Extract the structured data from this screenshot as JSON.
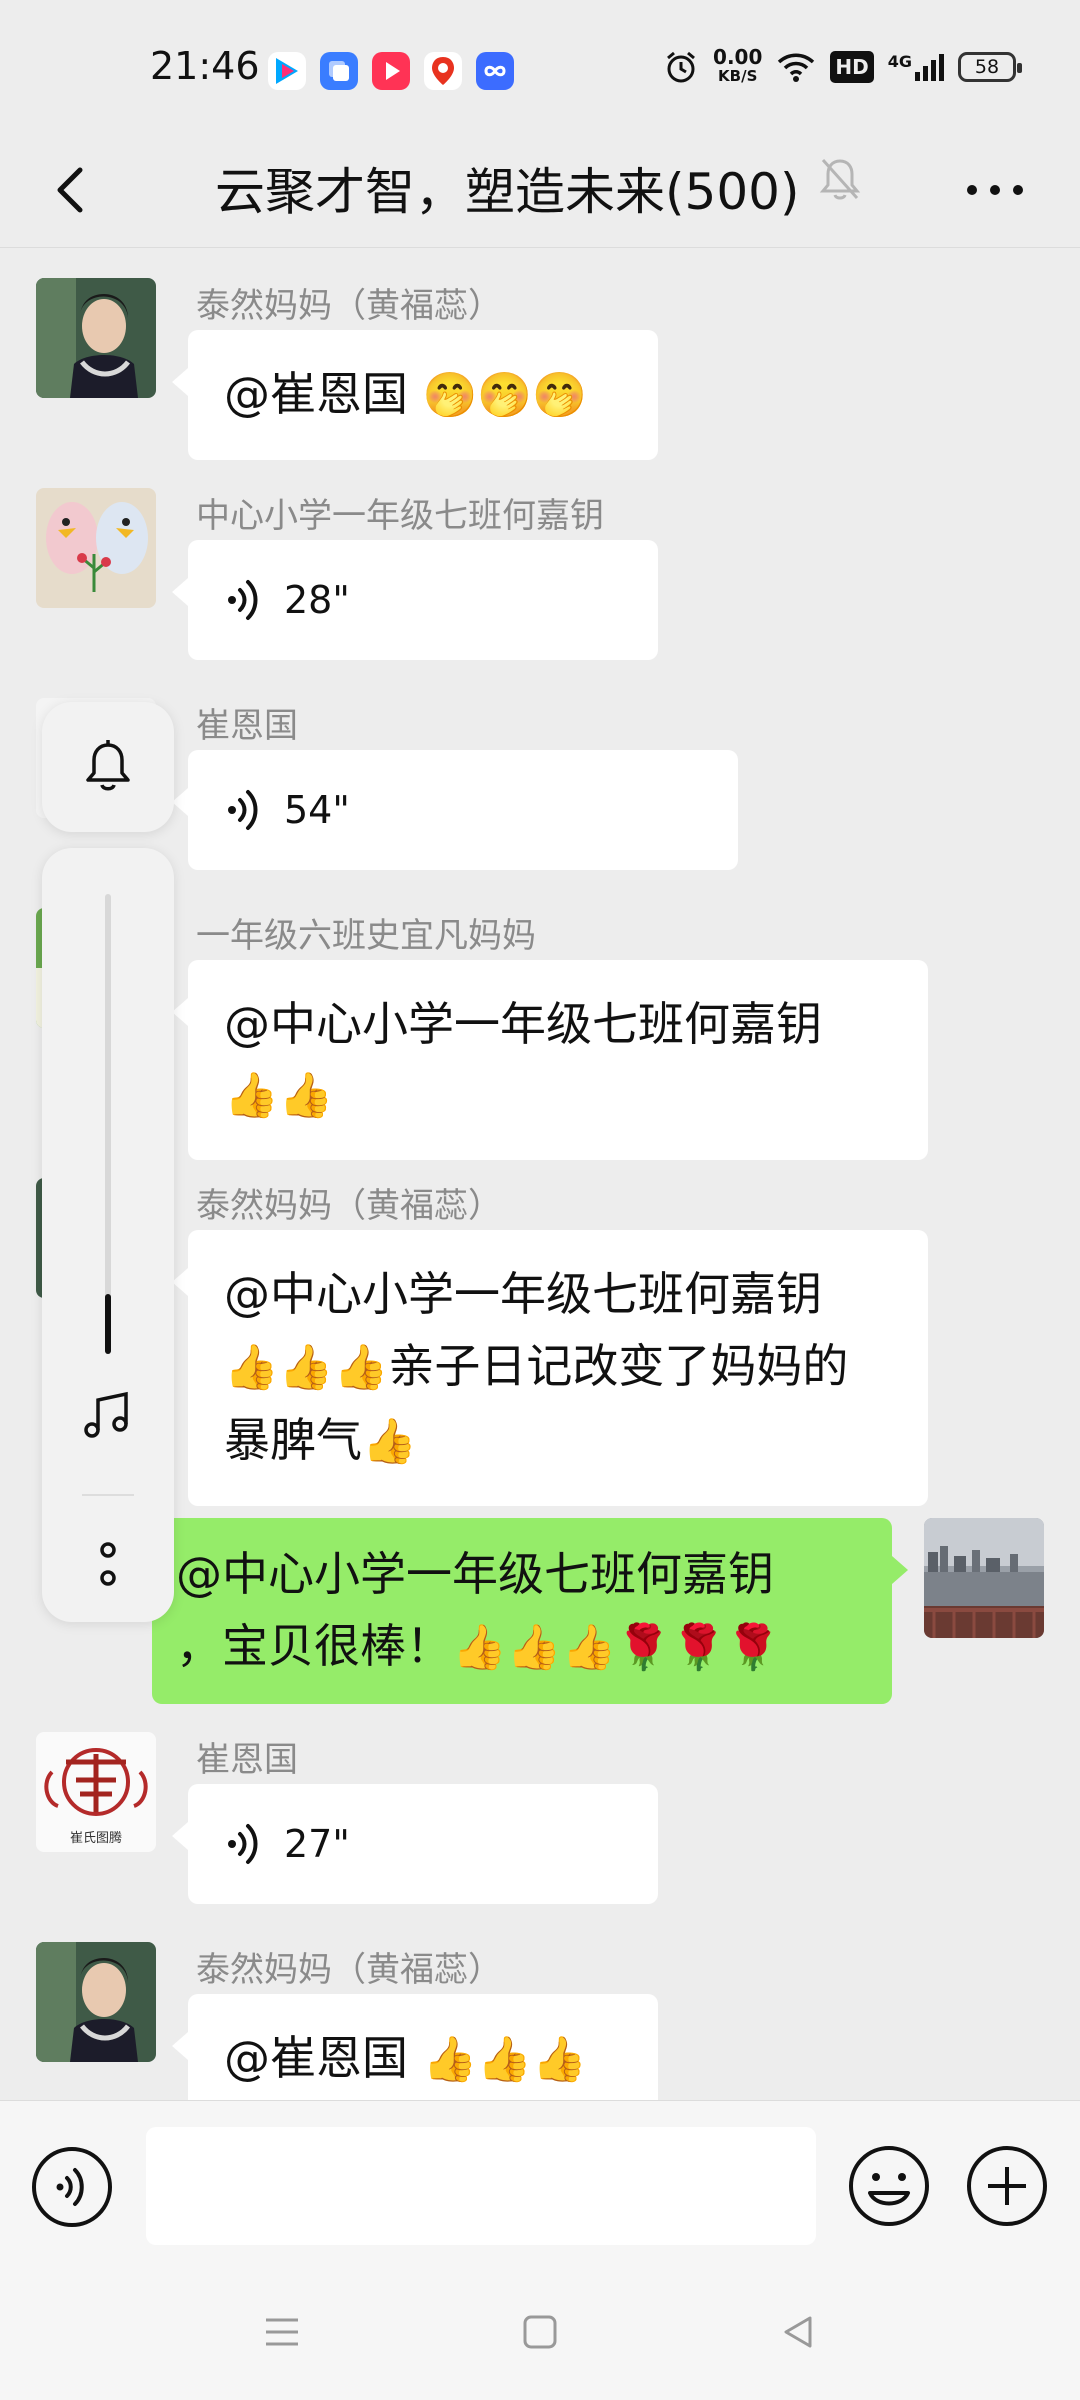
{
  "status_bar": {
    "time": "21:46",
    "net_speed_value": "0.00",
    "net_speed_unit": "KB/S",
    "hd_label": "HD",
    "signal_label": "4G",
    "battery": "58",
    "app_icons": [
      "youku-icon",
      "multitask-icon",
      "video-play-icon",
      "baidu-map-icon",
      "infinity-app-icon"
    ]
  },
  "header": {
    "back_icon": "chevron-left-icon",
    "title": "云聚才智，塑造未来(500)",
    "mute_icon": "bell-off-icon",
    "more_icon": "more-horizontal-icon"
  },
  "messages": [
    {
      "sender": "泰然妈妈（黄福蕊）",
      "text": "@崔恩国 ",
      "emoji": "🤭🤭🤭"
    },
    {
      "sender": "中心小学一年级七班何嘉钥",
      "voice_duration": "28\""
    },
    {
      "sender": "崔恩国",
      "voice_duration": "54\""
    },
    {
      "sender": "一年级六班史宜凡妈妈",
      "line1": "@中心小学一年级七班何嘉钥",
      "line2_emoji": "👍👍"
    },
    {
      "sender": "泰然妈妈（黄福蕊）",
      "line1": "@中心小学一年级七班何嘉钥",
      "line2_emoji": "👍👍👍",
      "line2_text": "亲子日记改变了妈妈的",
      "line3_text": "暴脾气",
      "line3_emoji": "👍"
    },
    {
      "line1": "@中心小学一年级七班何嘉钥",
      "line2_text": "，宝贝很棒！",
      "line2_emoji": "👍👍👍🌹🌹🌹"
    },
    {
      "sender": "崔恩国",
      "voice_duration": "27\"",
      "avatar_caption": "崔氏图腾"
    },
    {
      "sender": "泰然妈妈（黄福蕊）",
      "text": "@崔恩国 ",
      "emoji": "👍👍👍"
    }
  ],
  "floating_panel": {
    "bell_icon": "bell-icon",
    "volume_level": 0.13,
    "music_icon": "music-note-icon",
    "more_icon": "more-vertical-icon"
  },
  "input_bar": {
    "voice_button_icon": "voice-icon",
    "text_value": "",
    "emoji_button_icon": "smile-icon",
    "plus_button_icon": "plus-circle-icon"
  },
  "nav_bar": {
    "menu_icon": "menu-icon",
    "home_icon": "square-home-icon",
    "back_icon": "triangle-back-icon"
  },
  "colors": {
    "background": "#ededed",
    "my_bubble": "#95ec69",
    "other_bubble": "#ffffff",
    "sender_name": "#8a8a8a"
  }
}
